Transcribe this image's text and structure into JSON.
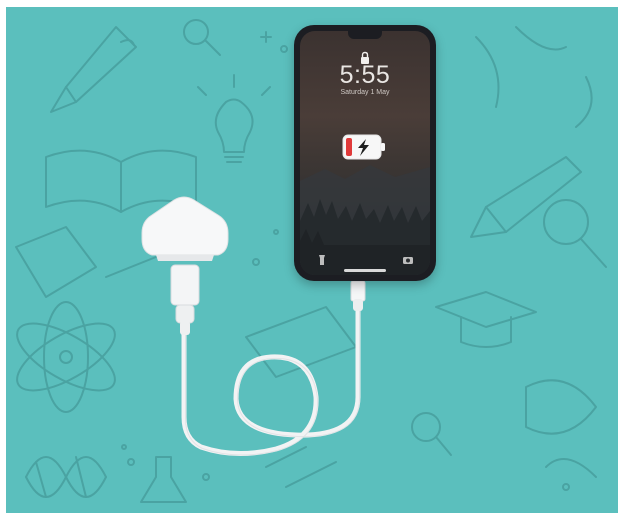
{
  "image": {
    "description_free": true
  },
  "phone": {
    "time": "5:55",
    "date": "Saturday 1 May"
  },
  "colors": {
    "background": "#5bbfbd",
    "doodle_line": "#4aa3a2",
    "phone_body": "#1c1d22",
    "battery_level": "#e03a3a",
    "charger": "#f4f5f6"
  },
  "icons": [
    "lock-icon",
    "battery-icon",
    "charging-bolt-icon",
    "flashlight-icon",
    "camera-icon"
  ]
}
